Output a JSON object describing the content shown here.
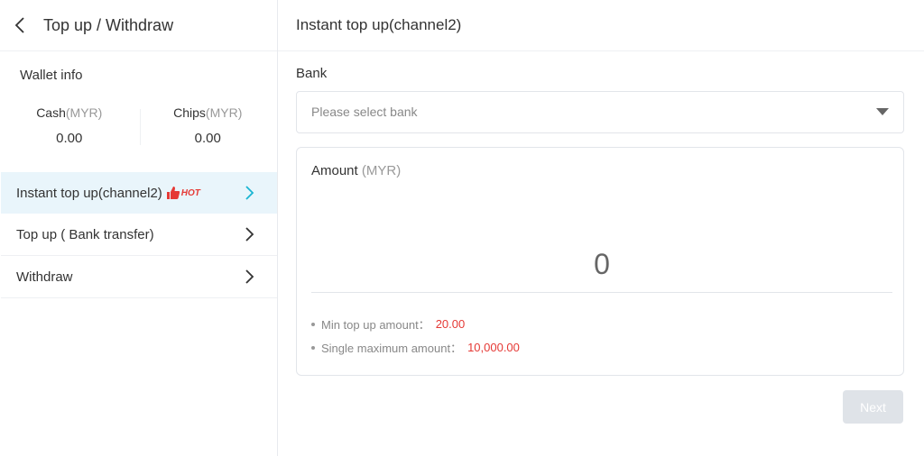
{
  "sidebar": {
    "title": "Top up / Withdraw",
    "wallet_info": "Wallet info",
    "cash": {
      "label": "Cash",
      "unit": "(MYR)",
      "value": "0.00"
    },
    "chips": {
      "label": "Chips",
      "unit": "(MYR)",
      "value": "0.00"
    },
    "menu": [
      {
        "label": "Instant top up(channel2)",
        "badge": "HOT",
        "active": true
      },
      {
        "label": "Top up ( Bank transfer)"
      },
      {
        "label": "Withdraw"
      }
    ]
  },
  "main": {
    "title": "Instant top up(channel2)",
    "bank_label": "Bank",
    "bank_placeholder": "Please select bank",
    "amount_label": "Amount",
    "amount_unit": "(MYR)",
    "amount_placeholder": "0",
    "hints": [
      {
        "label": "Min top up amount：",
        "value": "20.00"
      },
      {
        "label": "Single maximum amount：",
        "value": "10,000.00"
      }
    ],
    "next_label": "Next"
  },
  "colors": {
    "accent": "#19b5d2",
    "active_bg": "#e9f5fb",
    "highlight": "#e53935",
    "button_disabled": "#dfe3e8"
  }
}
